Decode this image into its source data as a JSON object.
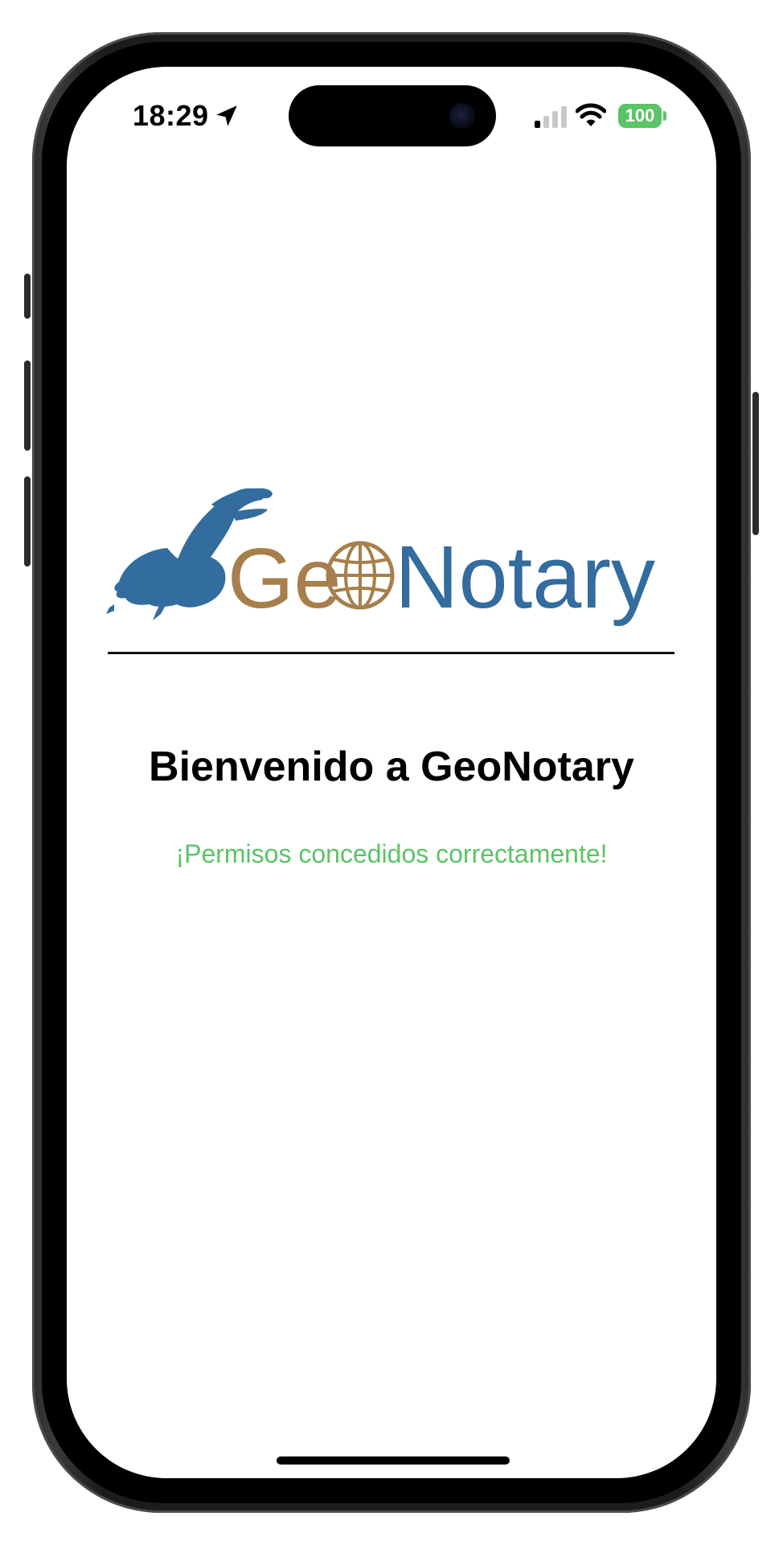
{
  "status_bar": {
    "time": "18:29",
    "battery_level": "100",
    "icons": [
      "location-arrow-icon",
      "cellular-signal-icon",
      "wifi-icon",
      "battery-icon"
    ]
  },
  "logo": {
    "text_geo": "Ge",
    "text_o_icon": "globe-icon",
    "text_notary": "Notary",
    "emblem": "quill-hand-icon",
    "brand_colors": {
      "gold": "#a67f4c",
      "blue": "#336c9e"
    }
  },
  "main": {
    "title": "Bienvenido a GeoNotary",
    "status_message": "¡Permisos concedidos correctamente!",
    "status_color": "#5ac466"
  }
}
